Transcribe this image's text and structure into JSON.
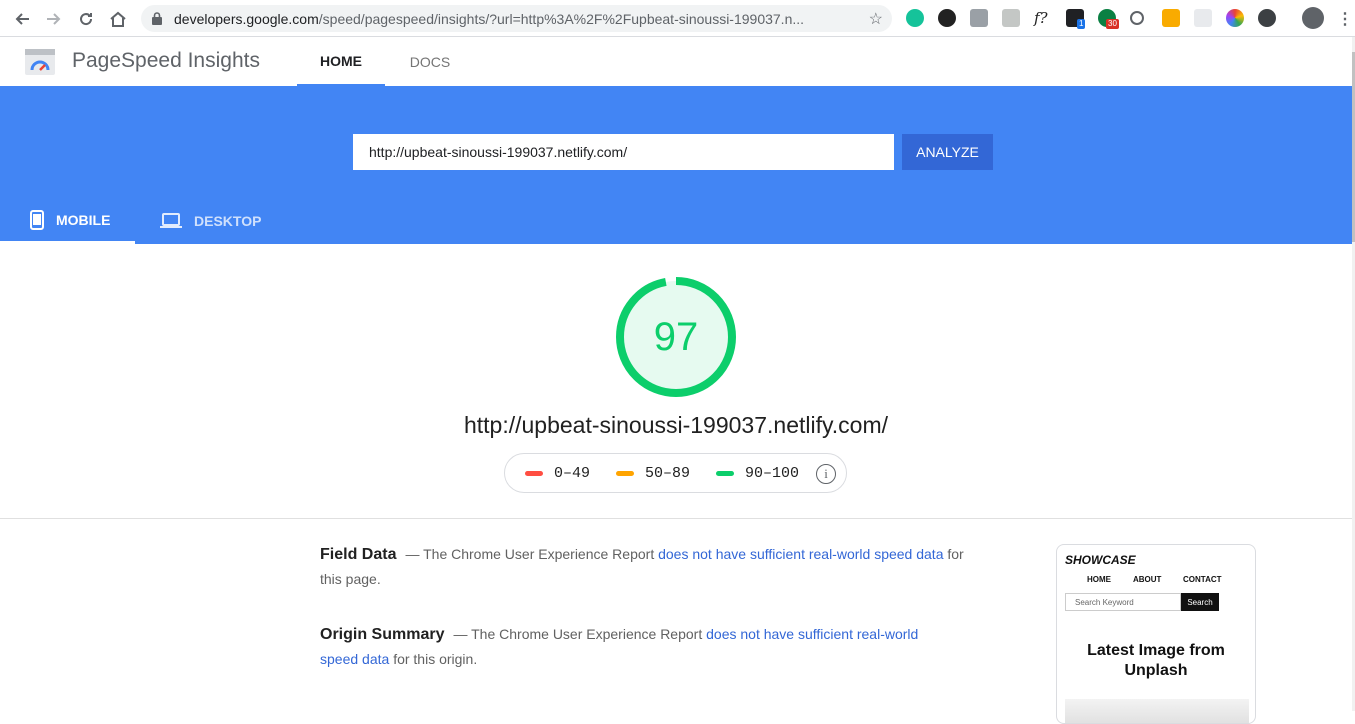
{
  "browser": {
    "url_host": "developers.google.com",
    "url_path": "/speed/pagespeed/insights/?url=http%3A%2F%2Fupbeat-sinoussi-199037.n...",
    "ext_badges": [
      "1",
      "30"
    ]
  },
  "header": {
    "brand": "PageSpeed Insights",
    "tabs": [
      {
        "label": "HOME"
      },
      {
        "label": "DOCS"
      }
    ]
  },
  "search": {
    "value": "http://upbeat-sinoussi-199037.netlify.com/",
    "button": "ANALYZE"
  },
  "devices": [
    {
      "label": "MOBILE"
    },
    {
      "label": "DESKTOP"
    }
  ],
  "score": {
    "value": "97",
    "fraction": 0.97,
    "color": "#0cce6b",
    "url": "http://upbeat-sinoussi-199037.netlify.com/"
  },
  "legend": [
    {
      "label": "0–49",
      "color": "#ff4e42"
    },
    {
      "label": "50–89",
      "color": "#ffa400"
    },
    {
      "label": "90–100",
      "color": "#0cce6b"
    }
  ],
  "field_data": {
    "title": "Field Data",
    "dash": "—",
    "text_before": "The Chrome User Experience Report",
    "link": "does not have sufficient real-world speed data",
    "text_after": "for this page."
  },
  "origin_summary": {
    "title": "Origin Summary",
    "dash": "—",
    "text_before": "The Chrome User Experience Report",
    "link": "does not have sufficient real-world speed data",
    "text_after": "for this origin."
  },
  "thumbnail": {
    "logo": "SHOWCASE",
    "nav": [
      "HOME",
      "ABOUT",
      "CONTACT"
    ],
    "search_placeholder": "Search Keyword",
    "search_button": "Search",
    "heading": "Latest Image from Unplash"
  }
}
